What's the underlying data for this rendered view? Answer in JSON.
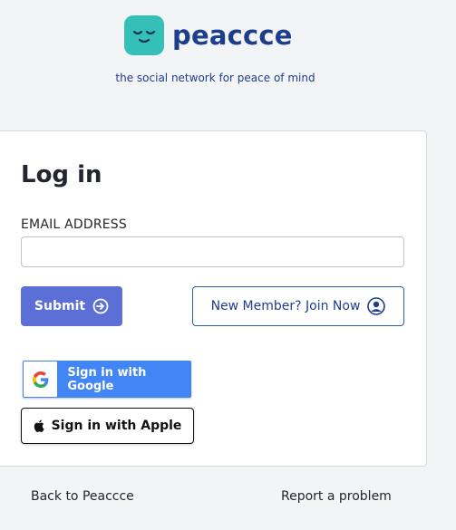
{
  "brand": {
    "name": "peaccce",
    "tagline": "the social network for peace of mind",
    "logo_color": "#34c0b6",
    "name_color": "#1d3e8c"
  },
  "login": {
    "title": "Log in",
    "email_label": "EMAIL ADDRESS",
    "email_value": "",
    "submit_label": "Submit",
    "submit_icon": "arrow-right-circle-icon",
    "join_label": "New Member? Join Now",
    "join_icon": "user-avatar-icon",
    "accent_color": "#5b6fd6"
  },
  "sso": {
    "google_label": "Sign in with Google",
    "google_color": "#4285f4",
    "apple_label": "Sign in with Apple"
  },
  "footer": {
    "back_label": "Back to Peaccce",
    "report_label": "Report a problem"
  }
}
